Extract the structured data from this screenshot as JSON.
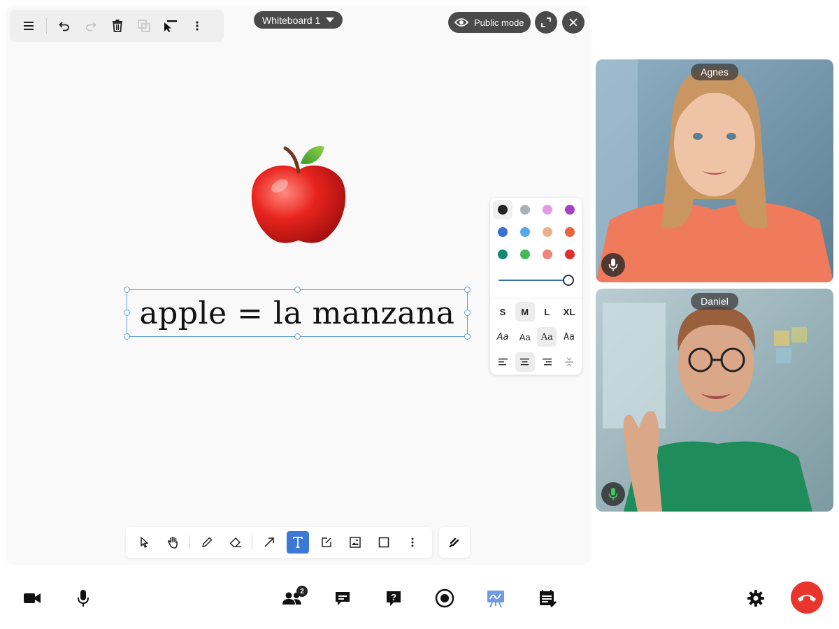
{
  "whiteboard": {
    "name": "Whiteboard 1",
    "public_mode_label": "Public mode",
    "text_object": "apple = la manzana",
    "image_object": "apple-emoji"
  },
  "top_toolbar": {
    "icons": [
      "menu-icon",
      "undo-icon",
      "redo-icon",
      "delete-icon",
      "duplicate-icon",
      "select-back-icon",
      "more-vertical-icon"
    ]
  },
  "style_panel": {
    "colors": [
      "#222222",
      "#a9b1b6",
      "#e39be8",
      "#a640c9",
      "#3b6fd6",
      "#58a8ea",
      "#e8b18f",
      "#e8643a",
      "#138a6f",
      "#45b95a",
      "#f0847a",
      "#e2312d"
    ],
    "selected_color": "#222222",
    "sizes": [
      "S",
      "M",
      "L",
      "XL"
    ],
    "selected_size": "M",
    "font_samples": [
      "Aa",
      "Aa",
      "Aa",
      "Aa"
    ],
    "selected_font_index": 2,
    "alignments": [
      "align-left-icon",
      "align-center-icon",
      "align-right-icon",
      "align-vertical-icon"
    ],
    "selected_alignment": "align-center-icon"
  },
  "draw_toolbar": {
    "tools": [
      "select-icon",
      "hand-icon",
      "pencil-icon",
      "eraser-icon",
      "arrow-icon",
      "text-icon",
      "note-icon",
      "image-icon",
      "rectangle-icon",
      "more-vertical-icon"
    ],
    "active_tool": "text-icon",
    "extra_tool": "laser-icon"
  },
  "participants": [
    {
      "name": "Agnes",
      "mic": "on",
      "mic_color": "#ffffff"
    },
    {
      "name": "Daniel",
      "mic": "speaking",
      "mic_color": "#3ecb62"
    }
  ],
  "bottom_bar": {
    "left": [
      "camera-icon",
      "microphone-icon"
    ],
    "center": [
      "participants-icon",
      "chat-icon",
      "qa-icon",
      "record-icon",
      "whiteboard-icon",
      "notes-icon"
    ],
    "participants_count": "2",
    "active_center": "whiteboard-icon",
    "right": [
      "settings-icon",
      "end-call-icon"
    ],
    "end_call_color": "#e8362d",
    "accent": "#3b78d8"
  }
}
